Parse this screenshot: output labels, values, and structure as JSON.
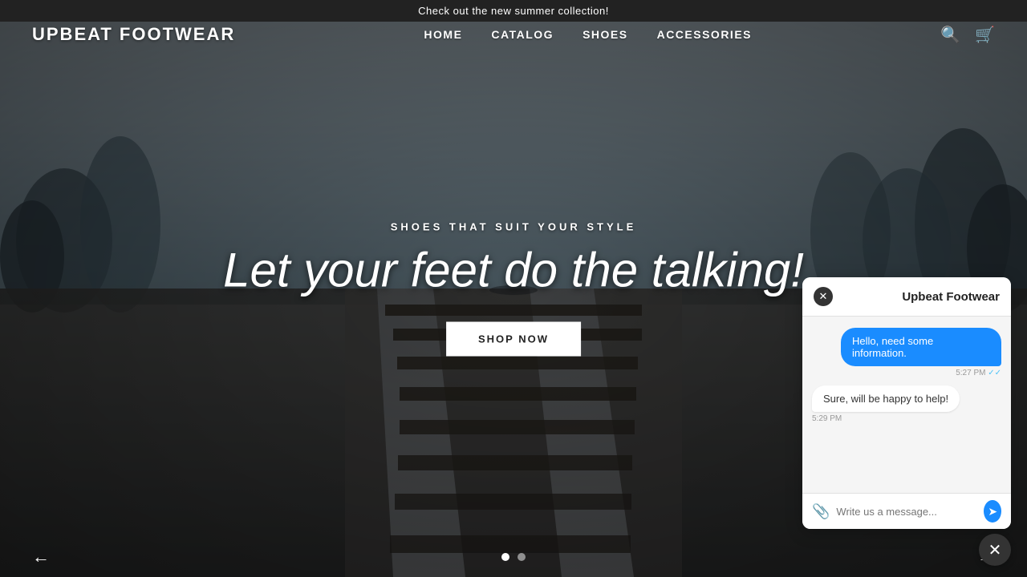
{
  "announcement": {
    "text": "Check out the new summer collection!"
  },
  "header": {
    "logo": "UPBEAT FOOTWEAR",
    "nav": [
      {
        "label": "HOME",
        "id": "home"
      },
      {
        "label": "CATALOG",
        "id": "catalog"
      },
      {
        "label": "SHOES",
        "id": "shoes"
      },
      {
        "label": "ACCESSORIES",
        "id": "accessories"
      }
    ]
  },
  "hero": {
    "subtitle": "SHOES THAT SUIT YOUR STYLE",
    "title": "Let your feet do the talking!",
    "cta": "SHOP NOW"
  },
  "chat": {
    "title": "Upbeat Footwear",
    "messages": [
      {
        "type": "sent",
        "text": "Hello, need some information.",
        "time": "5:27 PM"
      },
      {
        "type": "received",
        "text": "Sure, will be happy to help!",
        "time": "5:29 PM"
      }
    ],
    "input_placeholder": "Write us a message..."
  },
  "carousel": {
    "dots": [
      {
        "active": true
      },
      {
        "active": false
      }
    ]
  },
  "icons": {
    "search": "🔍",
    "cart": "🛒",
    "arrow_left": "←",
    "arrow_right": "→",
    "attach": "📎",
    "send": "➤",
    "close": "✕",
    "check": "✓✓"
  }
}
